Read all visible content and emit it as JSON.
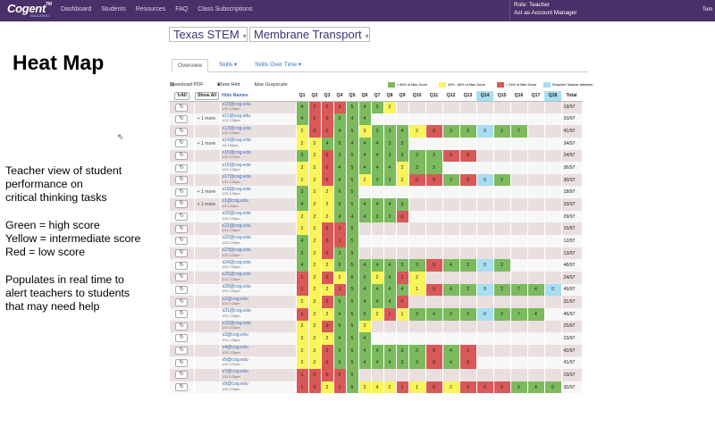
{
  "topbar": {
    "logo": "Cogent",
    "nav": [
      "Dashboard",
      "Students",
      "Resources",
      "FAQ",
      "Class Subscriptions"
    ],
    "role": "Role: Teacher",
    "account": "Act as Account Manager",
    "user": "Tom"
  },
  "heading": "Heat Map",
  "notes": [
    [
      "Teacher view of student",
      "performance on",
      "critical thinking tasks"
    ],
    [
      "Green = high score",
      "Yellow = intermediate score",
      "Red = low score"
    ],
    [
      "Populates in real time to",
      "alert teachers to students",
      "that may need help"
    ]
  ],
  "selects": {
    "course": "Texas STEM",
    "lesson": "Membrane Transport"
  },
  "tabs": [
    "Overview",
    "Skills",
    "Skills Over Time"
  ],
  "toolbar": {
    "pdf": "Download PDF",
    "hint": "Show Hint",
    "gray": "Use Grayscale"
  },
  "legend": [
    "> 66% of Max Score",
    "33% - 66% of Max Score",
    "< 33% of Max Score",
    "Requires Teacher Attention"
  ],
  "colors": {
    "high": "#7cba5e",
    "mid": "#f8f45a",
    "low": "#d95858",
    "attention": "#a8def1",
    "header": "#4a3068"
  },
  "table": {
    "all_button": "All",
    "show_all_button": "Show All",
    "hide_names": "Hide Names",
    "columns": [
      "Q1",
      "Q2",
      "Q3",
      "Q4",
      "Q5",
      "Q6",
      "Q7",
      "Q8",
      "Q9",
      "Q10",
      "Q11",
      "Q12",
      "Q13",
      "Q14",
      "Q15",
      "Q16",
      "Q17",
      "Q18",
      "Total"
    ],
    "highlight_columns": [
      "Q14",
      "Q18"
    ],
    "rows": [
      {
        "more": "",
        "email": "s10@cog.edu",
        "time": "1/21 2:26pm",
        "cells": [
          "G4",
          "R2",
          "R0",
          "R1",
          "G5",
          "G4",
          "G3",
          "Y2",
          "",
          "",
          "",
          "",
          "",
          "",
          "",
          "",
          "",
          "",
          ""
        ],
        "total": "19/97"
      },
      {
        "more": "+ 1 more",
        "email": "s11@cog.edu",
        "time": "1/21 2:26pm",
        "cells": [
          "G4",
          "R2",
          "R0",
          "G5",
          "G4",
          "G4",
          "",
          "",
          "",
          "",
          "",
          "",
          "",
          "",
          "",
          "",
          "",
          "",
          ""
        ],
        "total": "20/97"
      },
      {
        "more": "",
        "email": "s13@cog.edu",
        "time": "1/21 2:26pm",
        "cells": [
          "Y2",
          "R0",
          "R0",
          "G4",
          "G5",
          "Y3",
          "G3",
          "G3",
          "G4",
          "Y2",
          "R0",
          "G3",
          "G3",
          "B0",
          "G2",
          "G7",
          "",
          "",
          ""
        ],
        "total": "41/97"
      },
      {
        "more": "+ 1 more",
        "email": "s14@cog.edu",
        "time": "2/4 1:53pm",
        "cells": [
          "Y2",
          "Y2",
          "G4",
          "G5",
          "G4",
          "G4",
          "G4",
          "G3",
          "G3",
          "",
          "",
          "",
          "",
          "",
          "",
          "",
          "",
          "",
          ""
        ],
        "total": "34/97"
      },
      {
        "more": "",
        "email": "s15@cog.edu",
        "time": "1/21 2:27pm",
        "cells": [
          "G3",
          "Y2",
          "R0",
          "G3",
          "G5",
          "G4",
          "G4",
          "G3",
          "G3",
          "G3",
          "G3",
          "R0",
          "R0",
          "",
          "",
          "",
          "",
          "",
          ""
        ],
        "total": "34/97"
      },
      {
        "more": "",
        "email": "s16@cog.edu",
        "time": "1/21 2:26pm",
        "cells": [
          "Y2",
          "Y2",
          "R0",
          "G4",
          "G5",
          "G4",
          "G4",
          "G4",
          "Y2",
          "G3",
          "G3",
          "",
          "",
          "",
          "",
          "",
          "",
          "",
          ""
        ],
        "total": "36/97"
      },
      {
        "more": "",
        "email": "s17@cog.edu",
        "time": "1/21 2:25pm",
        "cells": [
          "Y2",
          "Y2",
          "R0",
          "G4",
          "G5",
          "Y2",
          "G3",
          "G3",
          "Y2",
          "R0",
          "R0",
          "G3",
          "R0",
          "B0",
          "G2",
          "",
          "",
          "",
          ""
        ],
        "total": "30/97"
      },
      {
        "more": "+ 1 more",
        "email": "s18@cog.edu",
        "time": "1/21 2:26pm",
        "cells": [
          "G3",
          "Y2",
          "Y2",
          "G6",
          "G5",
          "",
          "",
          "",
          "",
          "",
          "",
          "",
          "",
          "",
          "",
          "",
          "",
          "",
          ""
        ],
        "total": "18/97"
      },
      {
        "more": "+ 1 more",
        "email": "s1@cog.edu",
        "time": "2/4 1:16pm",
        "cells": [
          "G4",
          "Y2",
          "Y2",
          "G6",
          "G5",
          "G4",
          "G4",
          "G4",
          "G3",
          "",
          "",
          "",
          "",
          "",
          "",
          "",
          "",
          "",
          ""
        ],
        "total": "33/97"
      },
      {
        "more": "",
        "email": "s20@cog.edu",
        "time": "1/21 2:25pm",
        "cells": [
          "Y2",
          "Y2",
          "Y2",
          "G4",
          "G4",
          "G4",
          "G3",
          "G3",
          "R0",
          "",
          "",
          "",
          "",
          "",
          "",
          "",
          "",
          "",
          ""
        ],
        "total": "29/97"
      },
      {
        "more": "",
        "email": "s21@cog.edu",
        "time": "1/21 2:26pm",
        "cells": [
          "Y2",
          "Y2",
          "R0",
          "R1",
          "G5",
          "",
          "",
          "",
          "",
          "",
          "",
          "",
          "",
          "",
          "",
          "",
          "",
          "",
          ""
        ],
        "total": "15/97"
      },
      {
        "more": "",
        "email": "s22@cog.edu",
        "time": "1/21 2:24pm",
        "cells": [
          "G4",
          "Y2",
          "R0",
          "R1",
          "G5",
          "",
          "",
          "",
          "",
          "",
          "",
          "",
          "",
          "",
          "",
          "",
          "",
          "",
          ""
        ],
        "total": "12/97"
      },
      {
        "more": "",
        "email": "s23@cog.edu",
        "time": "1/21 2:24pm",
        "cells": [
          "G3",
          "Y2",
          "R0",
          "G3",
          "G5",
          "",
          "",
          "",
          "",
          "",
          "",
          "",
          "",
          "",
          "",
          "",
          "",
          "",
          ""
        ],
        "total": "13/97"
      },
      {
        "more": "",
        "email": "s24@cog.edu",
        "time": "1/21 2:25pm",
        "cells": [
          "G4",
          "Y2",
          "Y2",
          "G6",
          "G5",
          "G4",
          "G4",
          "G4",
          "G3",
          "G3",
          "R0",
          "G4",
          "G3",
          "B0",
          "G2",
          "",
          "",
          "",
          ""
        ],
        "total": "48/97"
      },
      {
        "more": "",
        "email": "s25@cog.edu",
        "time": "1/21 2:24pm",
        "cells": [
          "R1",
          "Y2",
          "R0",
          "Y2",
          "G6",
          "G5",
          "Y2",
          "G4",
          "R1",
          "Y2",
          "",
          "",
          "",
          "",
          "",
          "",
          "",
          "",
          ""
        ],
        "total": "24/97"
      },
      {
        "more": "",
        "email": "s28@cog.edu",
        "time": "1/21 2:24pm",
        "cells": [
          "R1",
          "Y2",
          "Y2",
          "R1",
          "G5",
          "G4",
          "G4",
          "G4",
          "G4",
          "Y1",
          "R0",
          "G4",
          "G3",
          "B0",
          "G2",
          "G7",
          "G4",
          "B0",
          ""
        ],
        "total": "49/97"
      },
      {
        "more": "",
        "email": "s2@cog.edu",
        "time": "1/21 2:25pm",
        "cells": [
          "Y2",
          "Y2",
          "R0",
          "G6",
          "G5",
          "G4",
          "G4",
          "G4",
          "R0",
          "",
          "",
          "",
          "",
          "",
          "",
          "",
          "",
          "",
          ""
        ],
        "total": "31/97"
      },
      {
        "more": "",
        "email": "s31@cog.edu",
        "time": "1/21 2:25pm",
        "cells": [
          "R1",
          "Y2",
          "Y2",
          "G4",
          "G5",
          "G3",
          "Y2",
          "R1",
          "Y1",
          "G3",
          "G4",
          "G3",
          "G3",
          "B0",
          "G2",
          "G7",
          "G4",
          "",
          ""
        ],
        "total": "46/97"
      },
      {
        "more": "",
        "email": "s32@cog.edu",
        "time": "1/21 2:25pm",
        "cells": [
          "Y2",
          "Y2",
          "R0",
          "G6",
          "G5",
          "Y3",
          "",
          "",
          "",
          "",
          "",
          "",
          "",
          "",
          "",
          "",
          "",
          "",
          ""
        ],
        "total": "25/97"
      },
      {
        "more": "",
        "email": "s3@cog.edu",
        "time": "1/21 2:26pm",
        "cells": [
          "Y2",
          "Y2",
          "Y2",
          "G4",
          "G5",
          "G4",
          "",
          "",
          "",
          "",
          "",
          "",
          "",
          "",
          "",
          "",
          "",
          "",
          ""
        ],
        "total": "23/97"
      },
      {
        "more": "",
        "email": "s4@cog.edu",
        "time": "1/21 2:26pm",
        "cells": [
          "Y2",
          "Y2",
          "R0",
          "G6",
          "G5",
          "G4",
          "G4",
          "G4",
          "G3",
          "G3",
          "R0",
          "G4",
          "R1",
          "",
          "",
          "",
          "",
          "",
          ""
        ],
        "total": "42/97"
      },
      {
        "more": "",
        "email": "s5@cog.edu",
        "time": "1/21 2:27pm",
        "cells": [
          "Y2",
          "Y2",
          "R0",
          "G6",
          "G5",
          "G4",
          "G4",
          "G4",
          "G3",
          "G3",
          "R0",
          "G4",
          "R0",
          "",
          "",
          "",
          "",
          "",
          ""
        ],
        "total": "41/97"
      },
      {
        "more": "",
        "email": "s7@cog.edu",
        "time": "1/21 2:25pm",
        "cells": [
          "R1",
          "R0",
          "R0",
          "R0",
          "G5",
          "",
          "",
          "",
          "",
          "",
          "",
          "",
          "",
          "",
          "",
          "",
          "",
          "",
          ""
        ],
        "total": "10/97"
      },
      {
        "more": "",
        "email": "s9@cog.edu",
        "time": "1/21 2:25pm",
        "cells": [
          "R1",
          "R0",
          "Y2",
          "R1",
          "G5",
          "Y2",
          "Y4",
          "Y2",
          "R1",
          "Y1",
          "R0",
          "Y2",
          "R0",
          "R0",
          "R0",
          "G5",
          "G4",
          "G0",
          ""
        ],
        "total": "30/97"
      }
    ]
  }
}
